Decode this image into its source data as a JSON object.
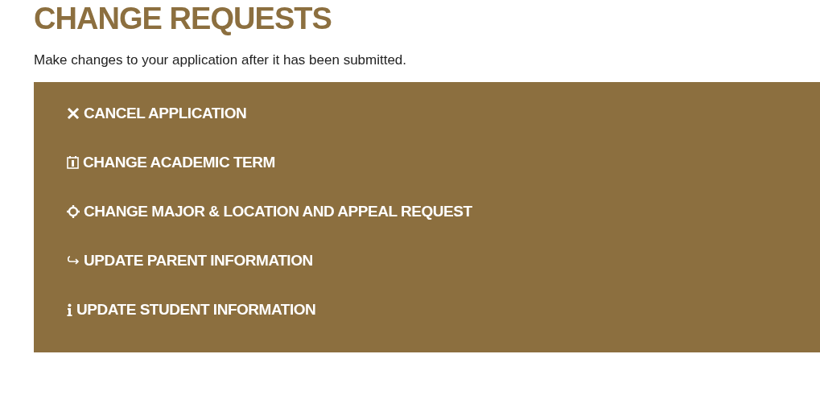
{
  "title": "CHANGE REQUESTS",
  "description": "Make changes to your application after it has been submitted.",
  "requests": [
    {
      "kind": "cancel",
      "label": "CANCEL APPLICATION"
    },
    {
      "kind": "term",
      "label": "CHANGE ACADEMIC TERM"
    },
    {
      "kind": "major",
      "label": "CHANGE MAJOR & LOCATION AND APPEAL REQUEST"
    },
    {
      "kind": "parent",
      "label": "UPDATE PARENT INFORMATION"
    },
    {
      "kind": "student",
      "label": "UPDATE STUDENT INFORMATION"
    }
  ]
}
